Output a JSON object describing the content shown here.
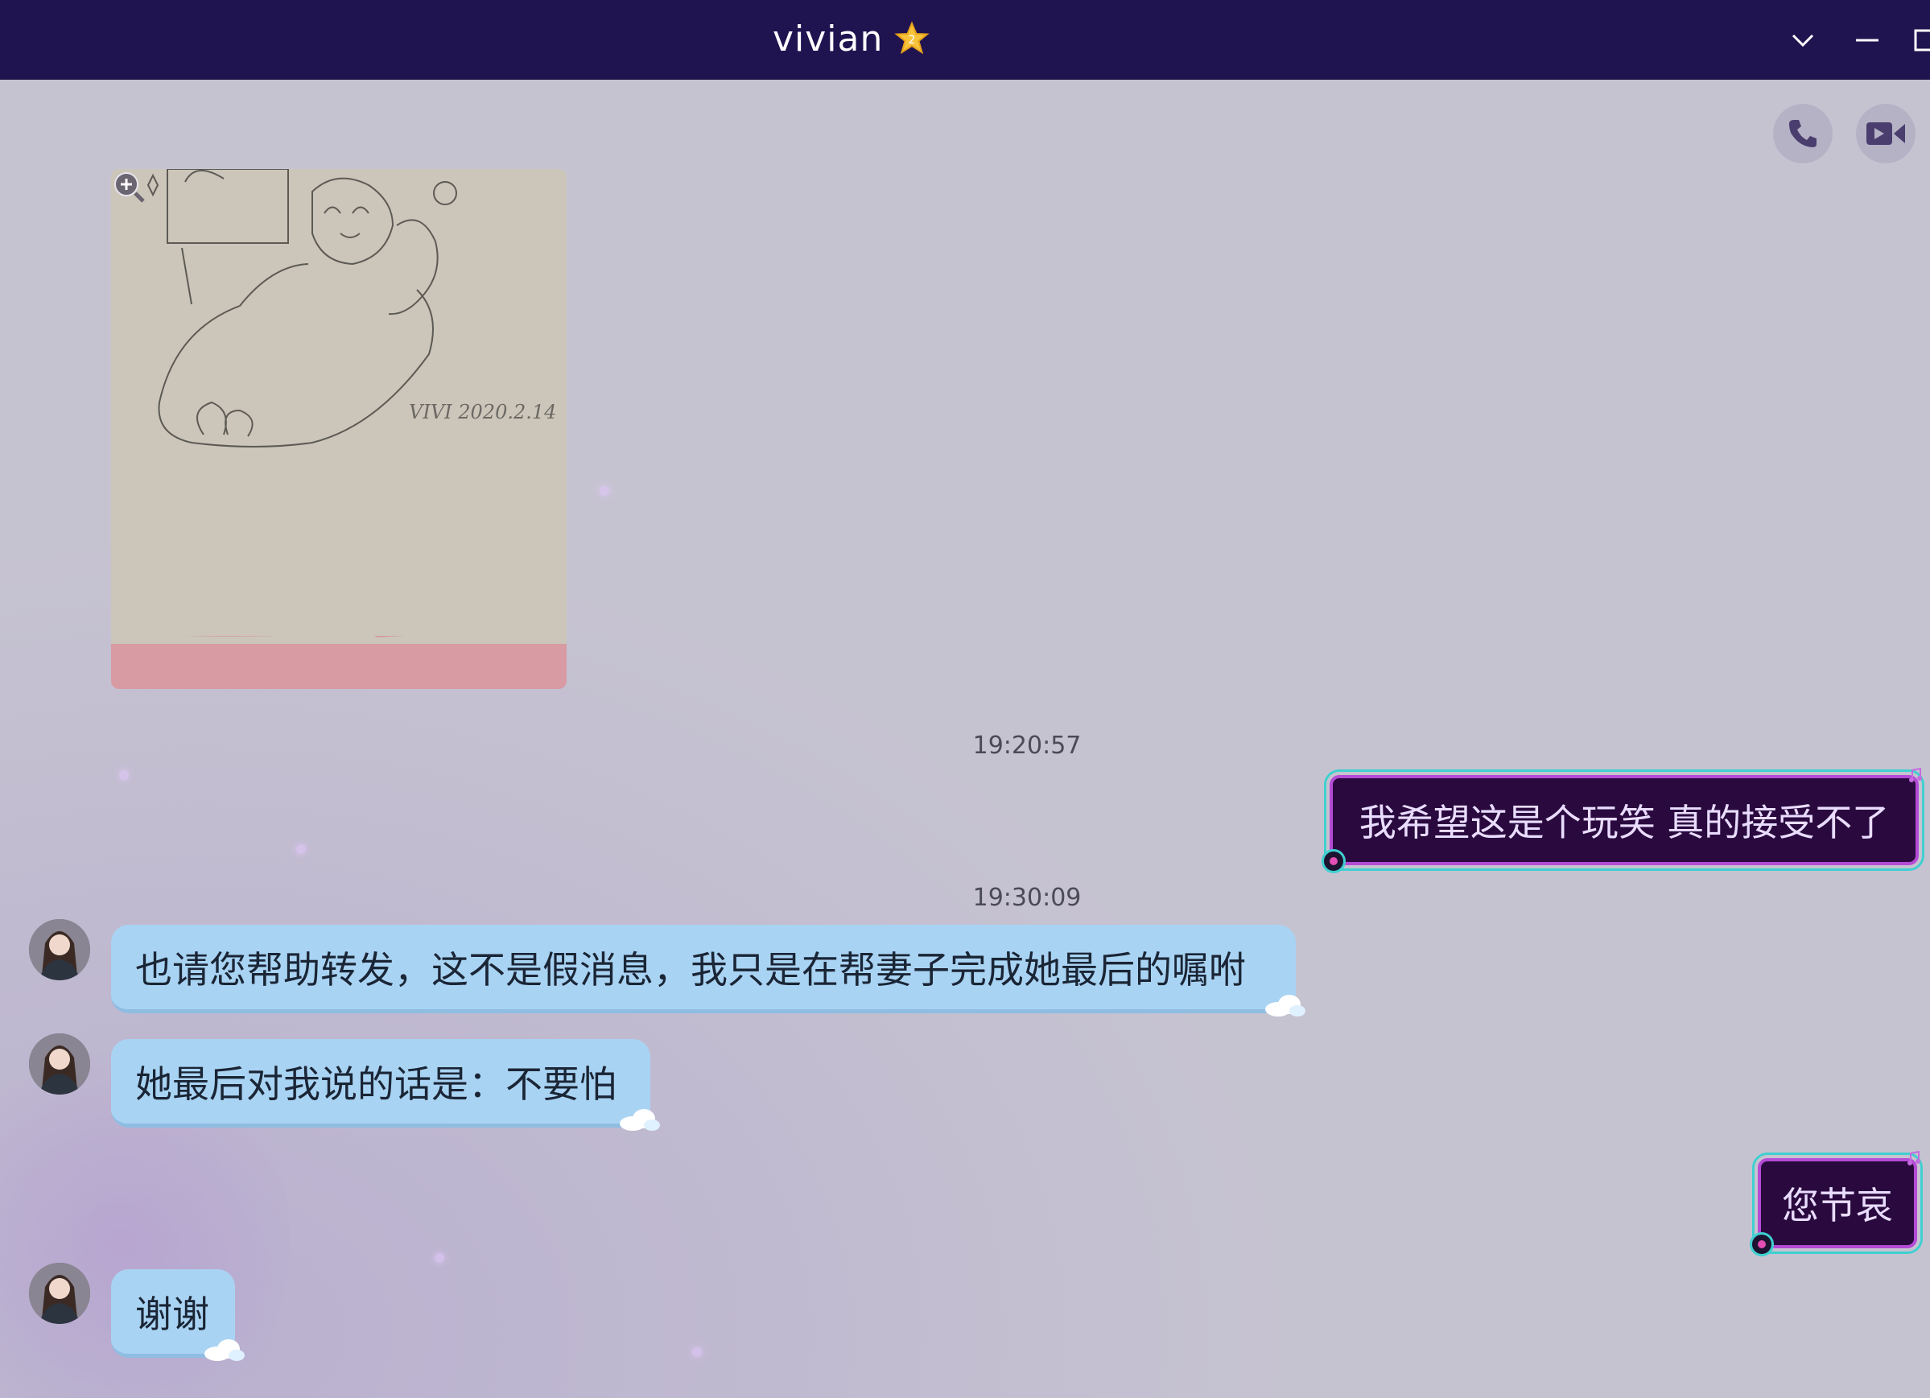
{
  "window": {
    "title": "vivian",
    "vip_level": "2",
    "controls": [
      "chevron-down-icon",
      "minimize-icon",
      "maximize-icon"
    ]
  },
  "toolbar": {
    "buttons": [
      "phone-icon",
      "video-call-icon"
    ]
  },
  "messages": [
    {
      "type": "image",
      "sender": "contact",
      "caption_in_image": "VIVI 2020.2.14"
    },
    {
      "type": "timestamp",
      "text": "19:20:57"
    },
    {
      "type": "text",
      "sender": "me",
      "text": "我希望这是个玩笑 真的接受不了"
    },
    {
      "type": "timestamp",
      "text": "19:30:09"
    },
    {
      "type": "text",
      "sender": "contact",
      "text": "也请您帮助转发，这不是假消息，我只是在帮妻子完成她最后的嘱咐"
    },
    {
      "type": "text",
      "sender": "contact",
      "text": "她最后对我说的话是：不要怕"
    },
    {
      "type": "text",
      "sender": "me",
      "text": "您节哀"
    },
    {
      "type": "text",
      "sender": "contact",
      "text": "谢谢"
    }
  ],
  "colors": {
    "titlebar": "#1f1350",
    "chat_background": "#c6c3d1",
    "incoming_bubble": "#a9d3f3",
    "outgoing_bubble": "#2a0a3e",
    "outgoing_border": "#b44bd6",
    "outgoing_outline": "#3fd0d0"
  }
}
